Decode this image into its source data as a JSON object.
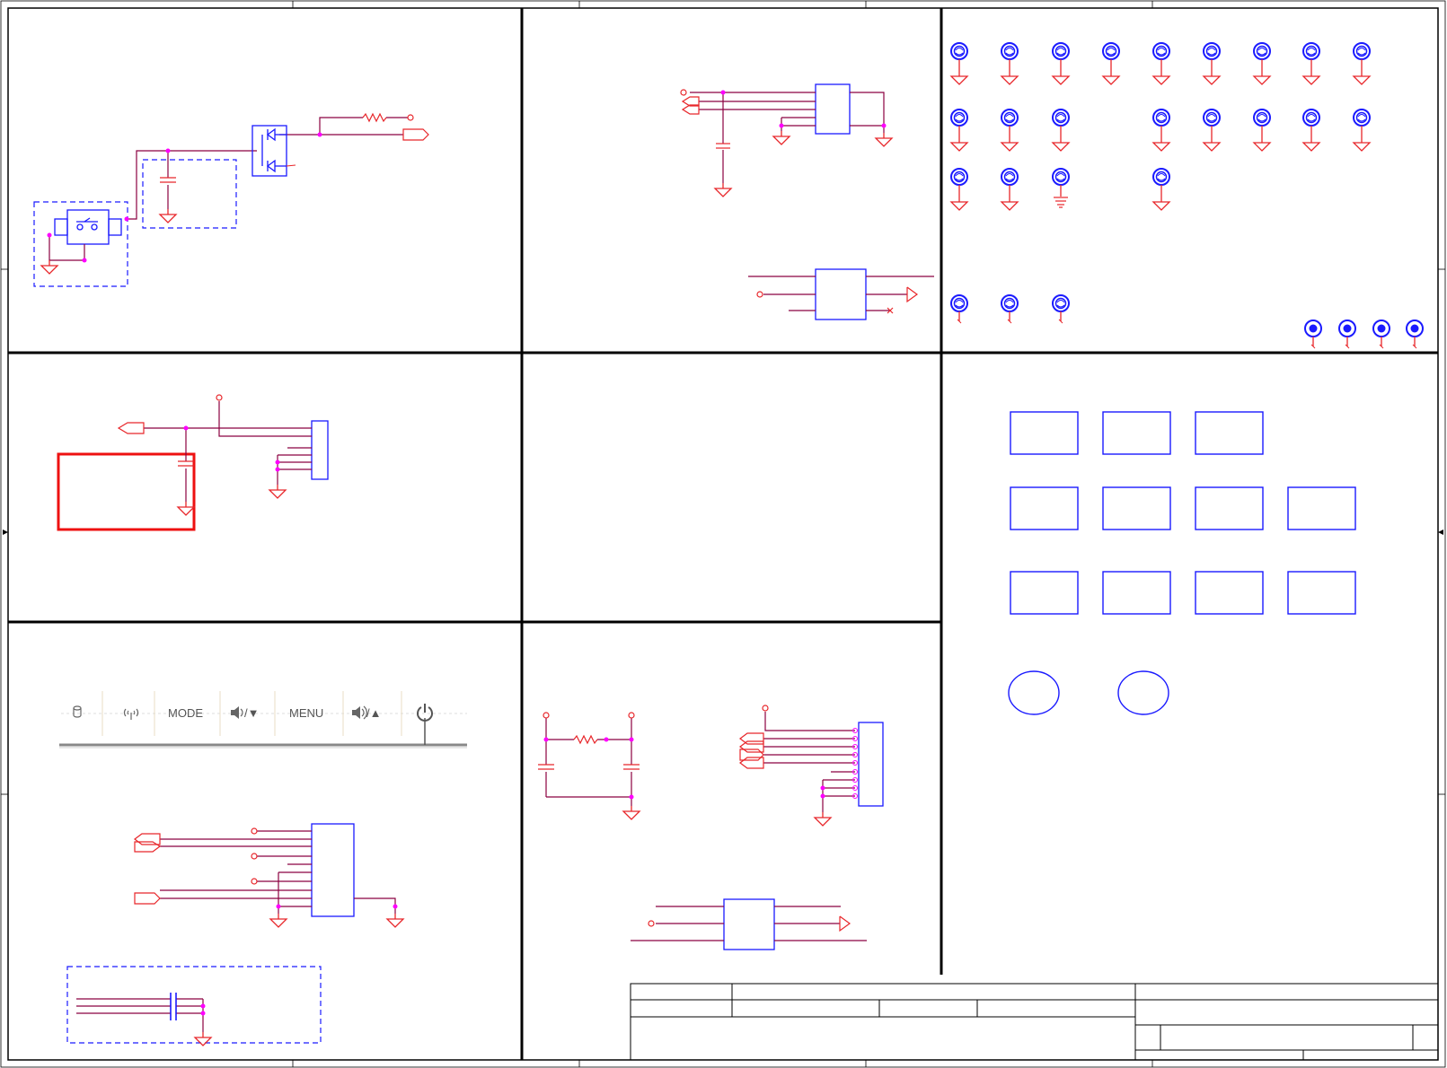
{
  "sheet": {
    "title": "",
    "colors": {
      "border": "#000000",
      "wire": "#8b0040",
      "symbol_red": "#e8262a",
      "component_blue": "#1a1aff",
      "junction": "#ff00ff",
      "highlight_box": "#ee1111",
      "keypad_text": "#555555"
    }
  },
  "keypad": {
    "icons": [
      "hdd-icon",
      "wireless-icon",
      "volume-down-icon",
      "volume-up-icon",
      "power-icon"
    ],
    "labels": {
      "mode": "MODE",
      "menu": "MENU",
      "vol_down_suffix": "/▼",
      "vol_up_suffix": "/▲"
    }
  },
  "mechanical": {
    "labels": {
      "screw_holes": "",
      "boxes": ""
    }
  }
}
